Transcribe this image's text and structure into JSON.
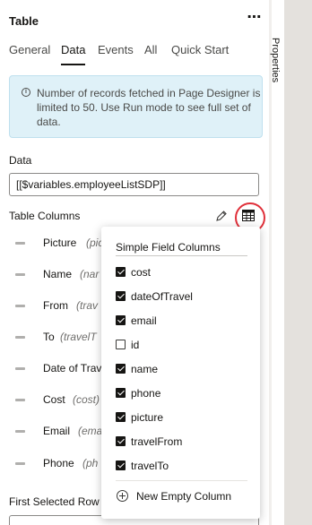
{
  "panel": {
    "title": "Table",
    "more_icon": "kebab-menu-icon"
  },
  "tabs": [
    {
      "label": "General",
      "active": false
    },
    {
      "label": "Data",
      "active": true
    },
    {
      "label": "Events",
      "active": false
    },
    {
      "label": "All",
      "active": false
    },
    {
      "label": "Quick Start",
      "active": false
    }
  ],
  "notice": {
    "icon": "info-icon",
    "text": "Number of records fetched in Page Designer is limited to 50. Use Run mode to see full set of data."
  },
  "data_field": {
    "label": "Data",
    "value": "[[$variables.employeeListSDP]]"
  },
  "table_columns": {
    "label": "Table Columns",
    "edit_icon": "pencil-icon",
    "add_icon": "table-columns-icon",
    "highlight_color": "#e0303a",
    "items": [
      {
        "name": "Picture",
        "type": "(pic"
      },
      {
        "name": "Name",
        "type": "(nar"
      },
      {
        "name": "From",
        "type": "(trav"
      },
      {
        "name": "To",
        "type": "(travelT"
      },
      {
        "name": "Date of Trav",
        "type": ""
      },
      {
        "name": "Cost",
        "type": "(cost)"
      },
      {
        "name": "Email",
        "type": "(ema"
      },
      {
        "name": "Phone",
        "type": "(ph"
      }
    ]
  },
  "first_selected_row": {
    "label": "First Selected Row"
  },
  "side_panel": {
    "label": "Properties"
  },
  "popup": {
    "title": "Simple Field Columns",
    "fields": [
      {
        "label": "cost",
        "checked": true
      },
      {
        "label": "dateOfTravel",
        "checked": true
      },
      {
        "label": "email",
        "checked": true
      },
      {
        "label": "id",
        "checked": false
      },
      {
        "label": "name",
        "checked": true
      },
      {
        "label": "phone",
        "checked": true
      },
      {
        "label": "picture",
        "checked": true
      },
      {
        "label": "travelFrom",
        "checked": true
      },
      {
        "label": "travelTo",
        "checked": true
      }
    ],
    "new_column_label": "New Empty Column",
    "new_column_icon": "plus-circle-icon"
  }
}
